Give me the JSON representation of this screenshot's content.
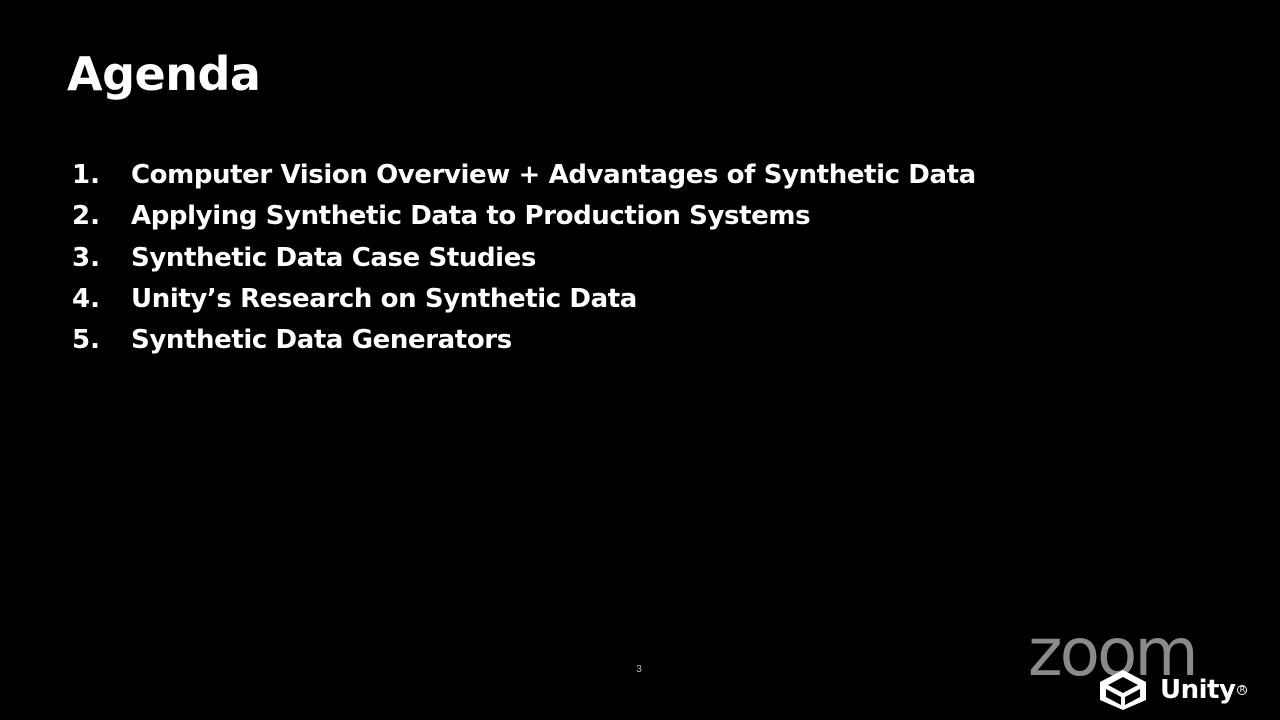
{
  "slide": {
    "title": "Agenda",
    "agenda": [
      {
        "number": "1.",
        "text": "Computer Vision Overview +  Advantages of Synthetic Data"
      },
      {
        "number": "2.",
        "text": "Applying Synthetic Data to Production Systems"
      },
      {
        "number": "3.",
        "text": "Synthetic Data Case Studies"
      },
      {
        "number": "4.",
        "text": "Unity’s Research on Synthetic Data"
      },
      {
        "number": "5.",
        "text": "Synthetic Data Generators"
      }
    ],
    "page_number": "3"
  },
  "branding": {
    "zoom_logo_text": "zoom",
    "unity_logo_text": "Unity",
    "unity_icon": "unity-cube-icon",
    "registered_mark": "R"
  },
  "colors": {
    "background": "#000000",
    "text": "#ffffff",
    "zoom_logo": "#8a8a8a"
  }
}
